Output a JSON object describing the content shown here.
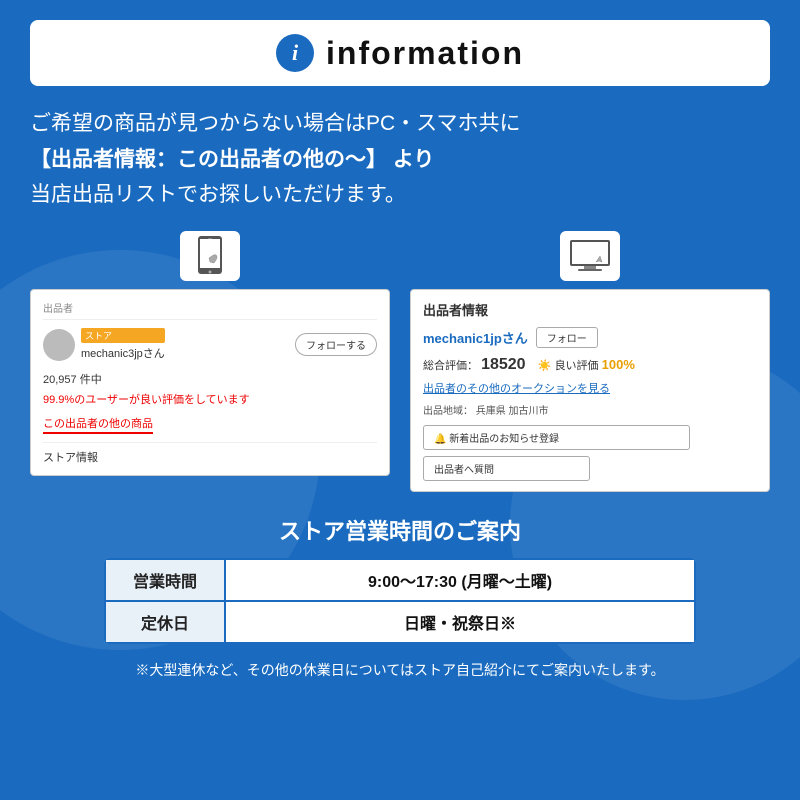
{
  "header": {
    "info_icon": "i",
    "title": "information"
  },
  "main_text": {
    "line1": "ご希望の商品が見つからない場合はPC・スマホ共に",
    "line2": "【出品者情報：この出品者の他の〜】 より",
    "line3": "当店出品リストでお探しいただけます。"
  },
  "screenshots": {
    "left": {
      "device_icon": "📱",
      "section_label": "出品者",
      "store_badge": "ストア",
      "username": "mechanic3jpさん",
      "follow_btn": "フォローする",
      "stats": "20,957 件中",
      "rating": "99.9%のユーザーが良い評価をしています",
      "other_items": "この出品者の他の商品",
      "store_info": "ストア情報"
    },
    "right": {
      "device_icon": "💻",
      "section_label": "出品者情報",
      "username": "mechanic1jpさん",
      "follow_btn": "フォロー",
      "rating_label": "総合評価：",
      "rating_score": "18520",
      "good_label": "良い評価",
      "good_pct": "100%",
      "auction_link": "出品者のその他のオークションを見る",
      "location_label": "出品地域：",
      "location": "兵庫県 加古川市",
      "notify_btn": "🔔 新着出品のお知らせ登録",
      "question_btn": "出品者へ質問"
    }
  },
  "store_hours": {
    "title": "ストア営業時間のご案内",
    "rows": [
      {
        "label": "営業時間",
        "value": "9:00〜17:30 (月曜〜土曜)"
      },
      {
        "label": "定休日",
        "value": "日曜・祝祭日※"
      }
    ]
  },
  "note": "※大型連休など、その他の休業日についてはストア自己紹介にてご案内いたします。"
}
